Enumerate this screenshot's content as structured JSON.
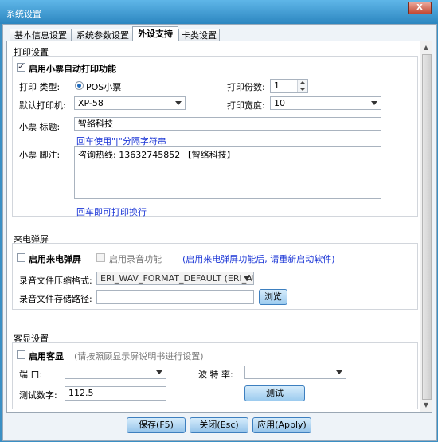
{
  "window": {
    "title": "系统设置",
    "close_label": "X"
  },
  "tabs": [
    {
      "label": "基本信息设置"
    },
    {
      "label": "系统参数设置"
    },
    {
      "label": "外设支持"
    },
    {
      "label": "卡类设置"
    }
  ],
  "print": {
    "section_title": "打印设置",
    "auto_print_label": "启用小票自动打印功能",
    "auto_print_checked": true,
    "type_label": "打印 类型:",
    "type_option": "POS小票",
    "copies_label": "打印份数:",
    "copies_value": "1",
    "printer_label": "默认打印机:",
    "printer_value": "XP-58",
    "width_label": "打印宽度:",
    "width_value": "10",
    "title_label": "小票 标题:",
    "title_value": "智络科技",
    "title_hint": "回车使用\"|\"分隔字符串",
    "footer_label": "小票 脚注:",
    "footer_value": "咨询热线: 13632745852 【智络科技】|",
    "footer_hint": "回车即可打印换行"
  },
  "caller": {
    "section_title": "来电弹屏",
    "enable_label": "启用来电弹屏",
    "enable_checked": false,
    "record_label": "启用录音功能",
    "record_checked": false,
    "notice": "(启用来电弹屏功能后, 请重新启动软件)",
    "format_label": "录音文件压缩格式:",
    "format_value": "ERI_WAV_FORMAT_DEFAULT (ERI_AUDI",
    "path_label": "录音文件存储路径:",
    "path_value": "",
    "browse_label": "浏览"
  },
  "display": {
    "section_title": "客显设置",
    "enable_label": "启用客显",
    "enable_checked": false,
    "notice": "(请按照顾显示屏说明书进行设置)",
    "port_label": "端    口:",
    "port_value": "",
    "baud_label": "波 特 率:",
    "baud_value": "",
    "test_num_label": "测试数字:",
    "test_num_value": "112.5",
    "test_button": "测试"
  },
  "footer": {
    "save": "保存(F5)",
    "close": "关闭(Esc)",
    "apply": "应用(Apply)"
  }
}
